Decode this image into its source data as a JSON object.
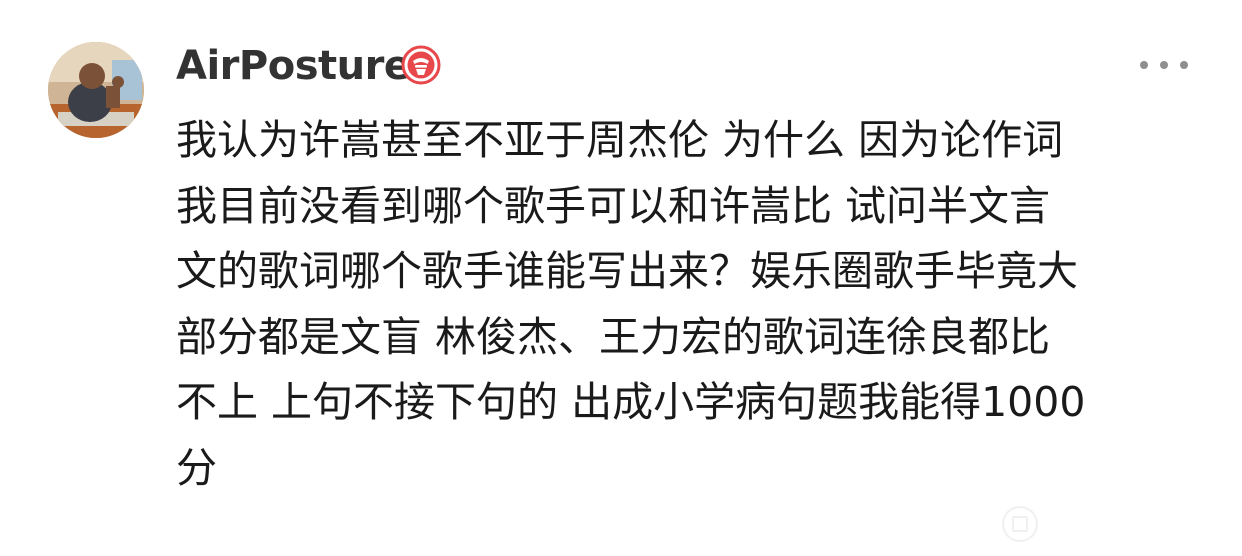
{
  "comment": {
    "author": {
      "username": "AirPosture",
      "avatar_icon": "user-avatar-photo",
      "badge_icon": "verified-badge-icon",
      "badge_color": "#e8484b"
    },
    "more_icon": "more-dots-icon",
    "lines": [
      "我认为许嵩甚至不亚于周杰伦 为什么 因为论作词",
      "我目前没看到哪个歌手可以和许嵩比 试问半文言",
      "文的歌词哪个歌手谁能写出来？娱乐圈歌手毕竟大",
      "部分都是文盲 林俊杰、王力宏的歌词连徐良都比",
      "不上 上句不接下句的 出成小学病句题我能得1000",
      "分"
    ]
  },
  "colors": {
    "username": "#333333",
    "body_text": "#1a1a1a",
    "more_dots": "#8f8f8f",
    "background": "#ffffff"
  }
}
